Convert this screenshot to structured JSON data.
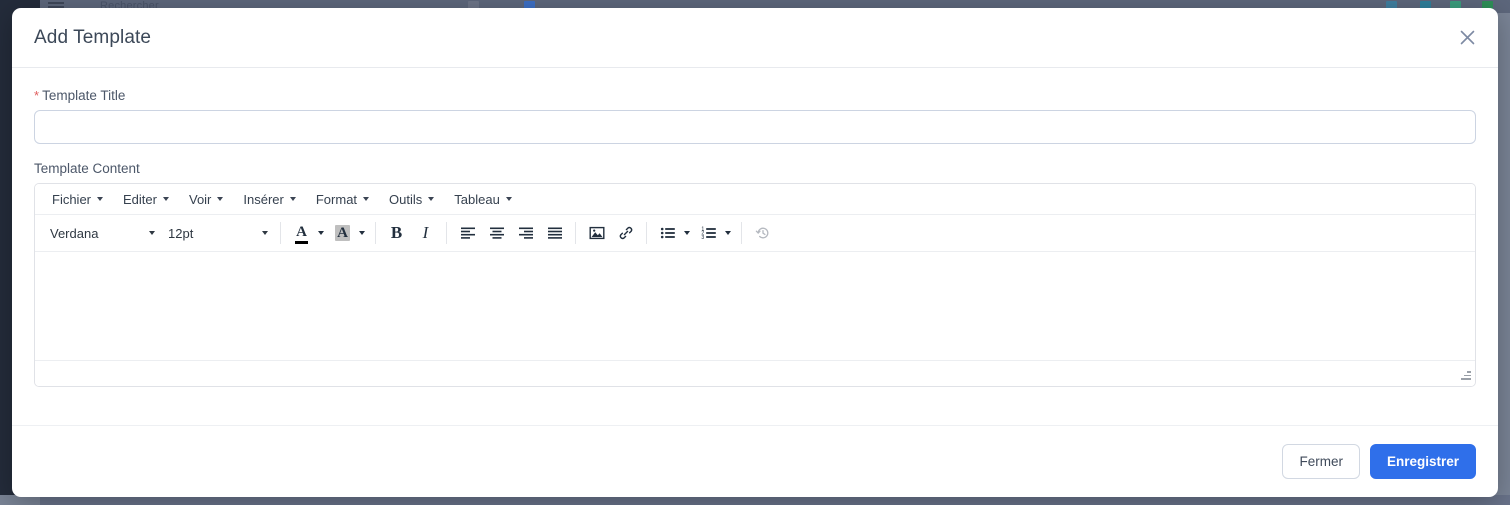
{
  "background": {
    "search_placeholder": "Rechercher",
    "hamburger_icon": "hamburger-menu-icon"
  },
  "modal": {
    "title": "Add Template",
    "close_icon": "close-icon",
    "colors": {
      "primary": "#2f6fea",
      "required_star": "#e05d5d",
      "title_text": "#3c4858",
      "border": "#ccd4e2"
    },
    "form": {
      "title_field": {
        "label": "Template Title",
        "required_marker": "*",
        "value": "",
        "placeholder": ""
      },
      "content_field": {
        "label": "Template Content",
        "value": ""
      }
    },
    "editor": {
      "menubar": [
        {
          "label": "Fichier"
        },
        {
          "label": "Editer"
        },
        {
          "label": "Voir"
        },
        {
          "label": "Insérer"
        },
        {
          "label": "Format"
        },
        {
          "label": "Outils"
        },
        {
          "label": "Tableau"
        }
      ],
      "toolbar": {
        "font_family": "Verdana",
        "font_size": "12pt",
        "buttons": [
          {
            "name": "forecolor-icon",
            "label": "A"
          },
          {
            "name": "backcolor-icon",
            "label": "A"
          },
          {
            "name": "bold-icon",
            "label": "B"
          },
          {
            "name": "italic-icon",
            "label": "I"
          },
          {
            "name": "align-left-icon"
          },
          {
            "name": "align-center-icon"
          },
          {
            "name": "align-right-icon"
          },
          {
            "name": "align-justify-icon"
          },
          {
            "name": "image-icon"
          },
          {
            "name": "link-icon"
          },
          {
            "name": "bullet-list-icon"
          },
          {
            "name": "numbered-list-icon"
          },
          {
            "name": "restore-draft-icon",
            "disabled": true
          }
        ]
      },
      "statusbar": {
        "text": "",
        "resize_handle": "resize-handle-icon"
      }
    },
    "footer": {
      "close_label": "Fermer",
      "save_label": "Enregistrer"
    }
  }
}
